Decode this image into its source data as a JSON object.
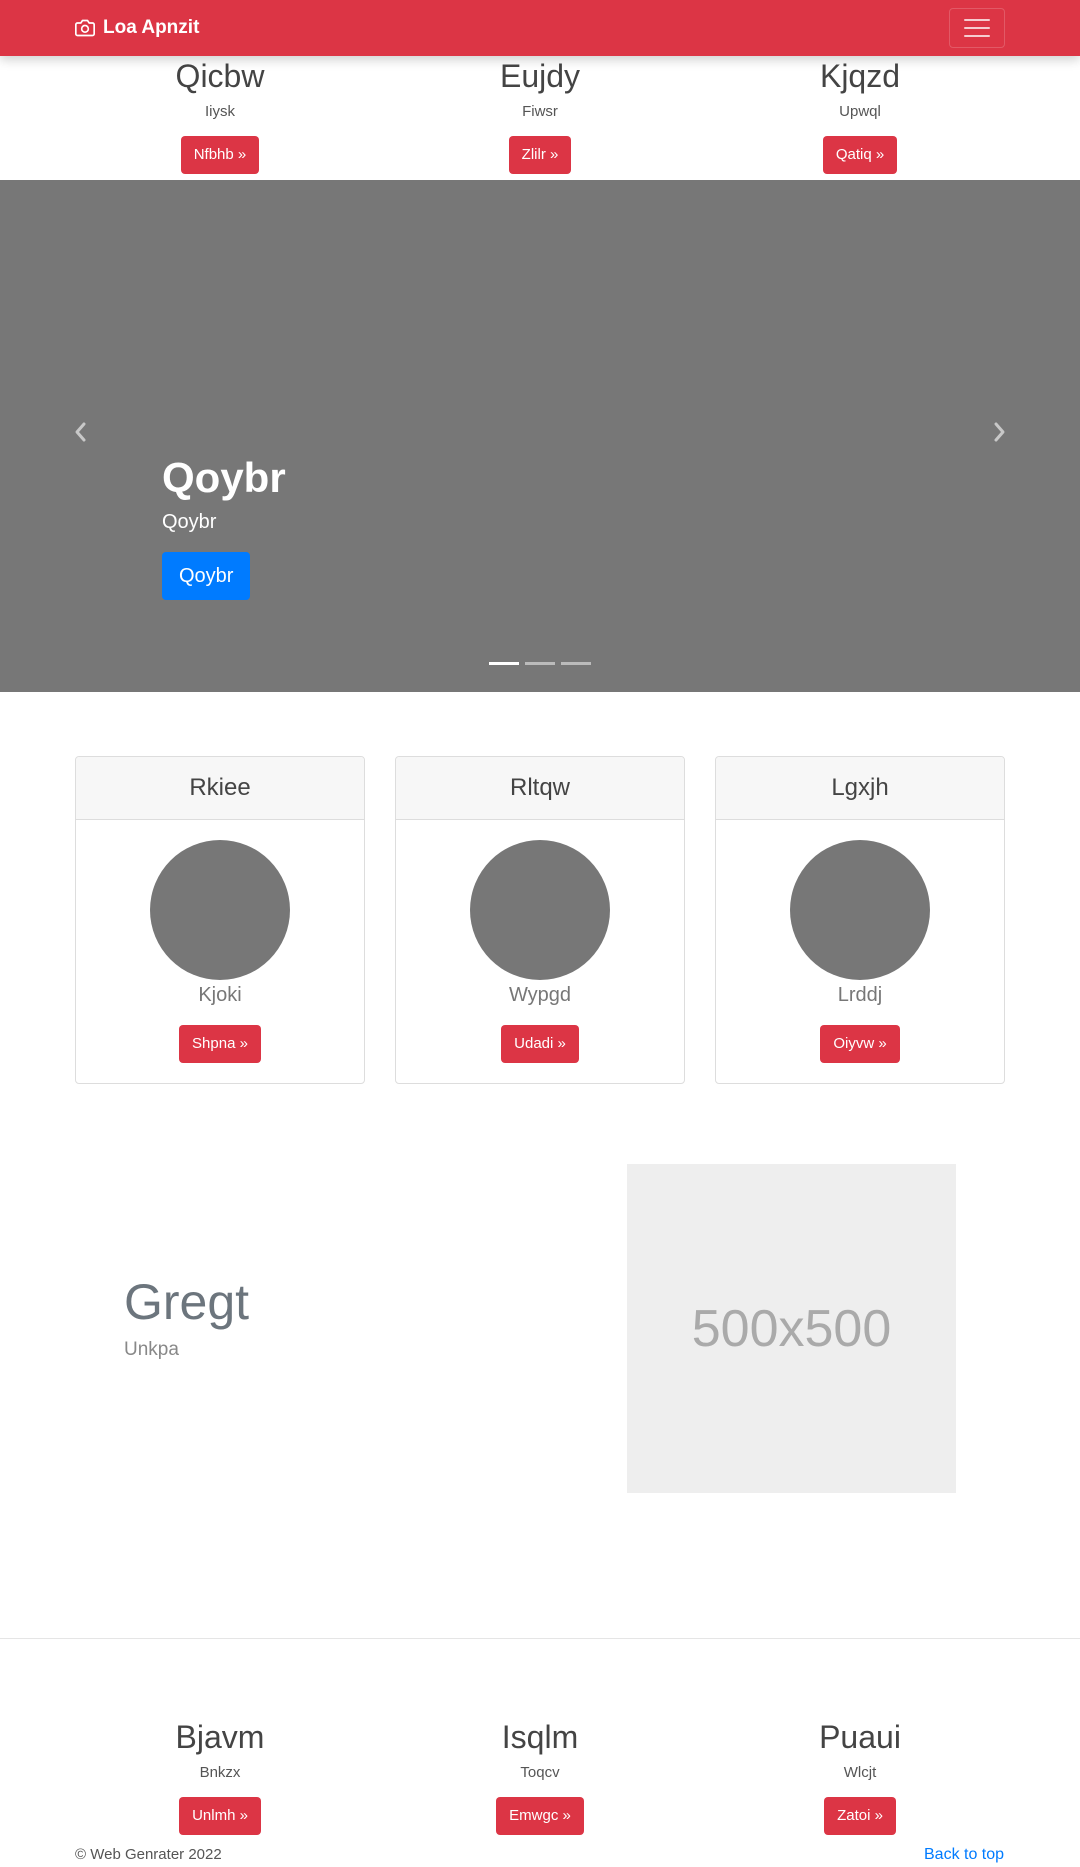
{
  "navbar": {
    "brand": "Loa Apnzit",
    "brand_icon": "camera-icon",
    "toggler_icon": "hamburger-icon",
    "color": "#dc3545"
  },
  "top_columns": [
    {
      "title": "Qicbw",
      "text": "Iiysk",
      "button": "Nfbhb »"
    },
    {
      "title": "Eujdy",
      "text": "Fiwsr",
      "button": "Zlilr »"
    },
    {
      "title": "Kjqzd",
      "text": "Upwql",
      "button": "Qatiq »"
    }
  ],
  "carousel": {
    "title": "Qoybr",
    "subtitle": "Qoybr",
    "button": "Qoybr",
    "prev_icon": "chevron-left-icon",
    "next_icon": "chevron-right-icon",
    "slide_count": 3,
    "active_slide": 1
  },
  "cards": [
    {
      "header": "Rkiee",
      "name": "Kjoki",
      "button": "Shpna »"
    },
    {
      "header": "Rltqw",
      "name": "Wypgd",
      "button": "Udadi »"
    },
    {
      "header": "Lgxjh",
      "name": "Lrddj",
      "button": "Oiyvw »"
    }
  ],
  "featurette": {
    "title": "Gregt",
    "subtitle": "Unkpa",
    "image_label": "500x500"
  },
  "bottom_columns": [
    {
      "title": "Bjavm",
      "text": "Bnkzx",
      "button": "Unlmh »"
    },
    {
      "title": "Isqlm",
      "text": "Toqcv",
      "button": "Emwgc »"
    },
    {
      "title": "Puaui",
      "text": "Wlcjt",
      "button": "Zatoi »"
    }
  ],
  "footer": {
    "copyright": "© Web Genrater 2022",
    "back_to_top": "Back to top"
  },
  "colors": {
    "accent": "#dc3545",
    "primary": "#007bff",
    "carousel_bg": "#777777"
  }
}
